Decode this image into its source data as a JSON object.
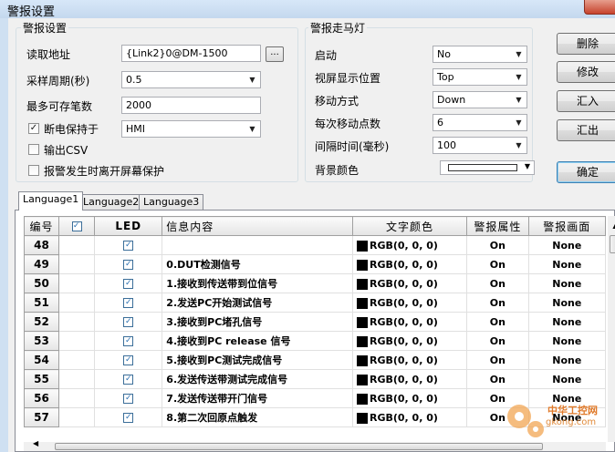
{
  "window": {
    "title": "警报设置"
  },
  "alarm_settings": {
    "title": "警报设置",
    "read_address_label": "读取地址",
    "read_address_value": "{Link2}0@DM-1500",
    "browse_label": "...",
    "sample_period_label": "采样周期(秒)",
    "sample_period_value": "0.5",
    "max_records_label": "最多可存笔数",
    "max_records_value": "2000",
    "power_off_keep_label": "断电保持于",
    "power_off_keep_checked": "✓",
    "power_off_keep_value": "HMI",
    "output_csv_label": "输出CSV",
    "screensaver_label": "报警发生时离开屏幕保护"
  },
  "marquee": {
    "title": "警报走马灯",
    "enable_label": "启动",
    "enable_value": "No",
    "position_label": "视屏显示位置",
    "position_value": "Top",
    "move_mode_label": "移动方式",
    "move_mode_value": "Down",
    "move_points_label": "每次移动点数",
    "move_points_value": "6",
    "interval_label": "间隔时间(毫秒)",
    "interval_value": "100",
    "bg_color_label": "背景颜色"
  },
  "buttons": {
    "delete": "删除",
    "modify": "修改",
    "import": "汇入",
    "export": "汇出",
    "ok": "确定"
  },
  "tabs": [
    {
      "label": "Language1"
    },
    {
      "label": "Language2"
    },
    {
      "label": "Language3"
    }
  ],
  "table": {
    "headers": {
      "num": "编号",
      "led": "LED",
      "msg": "信息内容",
      "color": "文字颜色",
      "attr": "警报属性",
      "screen": "警报画面"
    },
    "header_check": "✓",
    "rows": [
      {
        "num": "48",
        "led": "✓",
        "msg": "",
        "color": "RGB(0, 0, 0)",
        "attr": "On",
        "screen": "None"
      },
      {
        "num": "49",
        "led": "✓",
        "msg": "0.DUT检测信号",
        "color": "RGB(0, 0, 0)",
        "attr": "On",
        "screen": "None"
      },
      {
        "num": "50",
        "led": "✓",
        "msg": "1.接收到传送带到位信号",
        "color": "RGB(0, 0, 0)",
        "attr": "On",
        "screen": "None"
      },
      {
        "num": "51",
        "led": "✓",
        "msg": "2.发送PC开始测试信号",
        "color": "RGB(0, 0, 0)",
        "attr": "On",
        "screen": "None"
      },
      {
        "num": "52",
        "led": "✓",
        "msg": "3.接收到PC堵孔信号",
        "color": "RGB(0, 0, 0)",
        "attr": "On",
        "screen": "None"
      },
      {
        "num": "53",
        "led": "✓",
        "msg": "4.接收到PC release 信号",
        "color": "RGB(0, 0, 0)",
        "attr": "On",
        "screen": "None"
      },
      {
        "num": "54",
        "led": "✓",
        "msg": "5.接收到PC测试完成信号",
        "color": "RGB(0, 0, 0)",
        "attr": "On",
        "screen": "None"
      },
      {
        "num": "55",
        "led": "✓",
        "msg": "6.发送传送带测试完成信号",
        "color": "RGB(0, 0, 0)",
        "attr": "On",
        "screen": "None"
      },
      {
        "num": "56",
        "led": "✓",
        "msg": "7.发送传送带开门信号",
        "color": "RGB(0, 0, 0)",
        "attr": "On",
        "screen": "None"
      },
      {
        "num": "57",
        "led": "✓",
        "msg": "8.第二次回原点触发",
        "color": "RGB(0, 0, 0)",
        "attr": "On",
        "screen": "None"
      }
    ]
  },
  "watermark": {
    "text_cn": "中华工控网",
    "text_url": "gkong.com"
  }
}
